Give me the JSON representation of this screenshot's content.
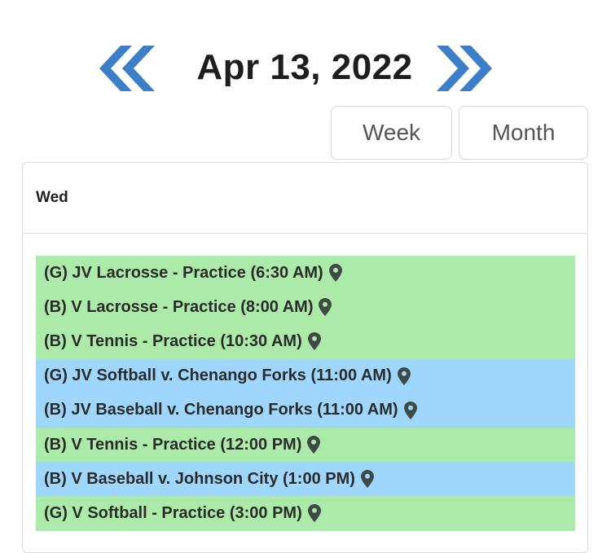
{
  "header": {
    "date": "Apr 13, 2022",
    "prev_icon": "double-chevron-left-icon",
    "next_icon": "double-chevron-right-icon",
    "accent_color": "#3d7ec9"
  },
  "views": {
    "week_label": "Week",
    "month_label": "Month"
  },
  "day": {
    "label": "Wed"
  },
  "events": [
    {
      "text": "(G) JV Lacrosse - Practice (6:30 AM)",
      "type": "practice"
    },
    {
      "text": "(B) V Lacrosse - Practice (8:00 AM)",
      "type": "practice"
    },
    {
      "text": "(B) V Tennis - Practice (10:30 AM)",
      "type": "practice"
    },
    {
      "text": "(G) JV Softball v. Chenango Forks (11:00 AM)",
      "type": "game"
    },
    {
      "text": "(B) JV Baseball v. Chenango Forks (11:00 AM)",
      "type": "game"
    },
    {
      "text": "(B) V Tennis - Practice (12:00 PM)",
      "type": "practice"
    },
    {
      "text": "(B) V Baseball v. Johnson City (1:00 PM)",
      "type": "game"
    },
    {
      "text": "(G) V Softball - Practice (3:00 PM)",
      "type": "practice"
    }
  ],
  "colors": {
    "practice": "#abeaa8",
    "game": "#9fd6fb"
  },
  "event_icon": "map-pin-icon"
}
